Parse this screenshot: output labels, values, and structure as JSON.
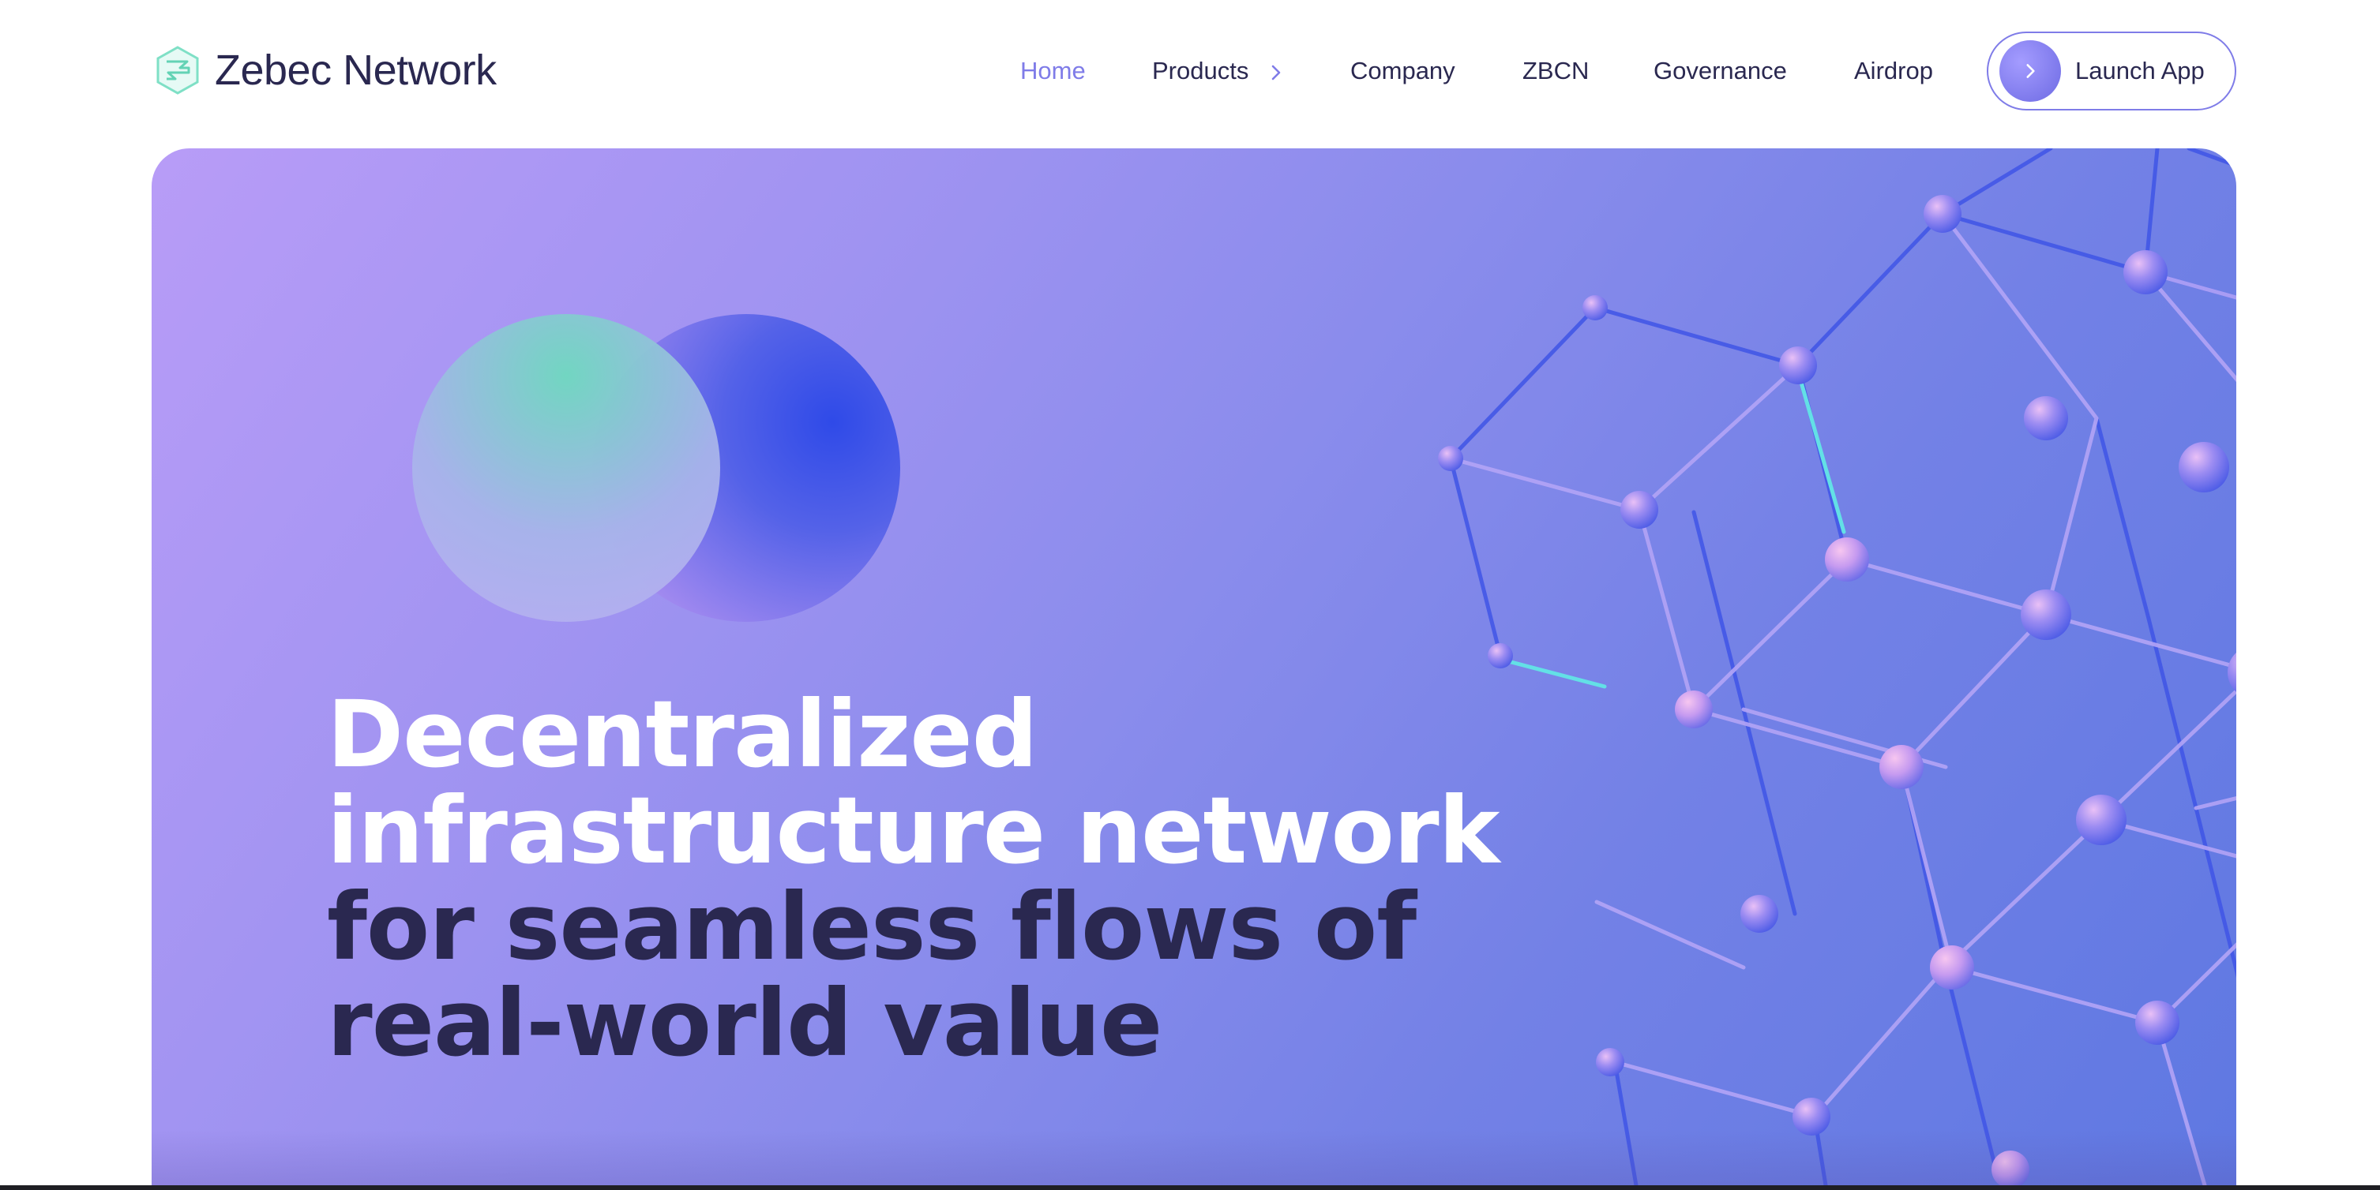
{
  "brand": {
    "name": "Zebec Network",
    "accent_color": "#7f7ce8",
    "text_color": "#2a2850"
  },
  "nav": {
    "items": [
      {
        "label": "Home",
        "active": true
      },
      {
        "label": "Products",
        "has_submenu": true,
        "icon": "chevron-right-icon"
      },
      {
        "label": "Company"
      },
      {
        "label": "ZBCN"
      },
      {
        "label": "Governance"
      },
      {
        "label": "Airdrop"
      }
    ],
    "launch_button": {
      "label": "Launch App",
      "icon": "chevron-right-icon"
    }
  },
  "hero": {
    "headline_white": "Decentralized infrastructure network",
    "headline_dark": "for seamless flows of real-world value",
    "gradient_colors": [
      "#b89cf7",
      "#9f93f1",
      "#7381e6",
      "#5f78e2"
    ]
  }
}
